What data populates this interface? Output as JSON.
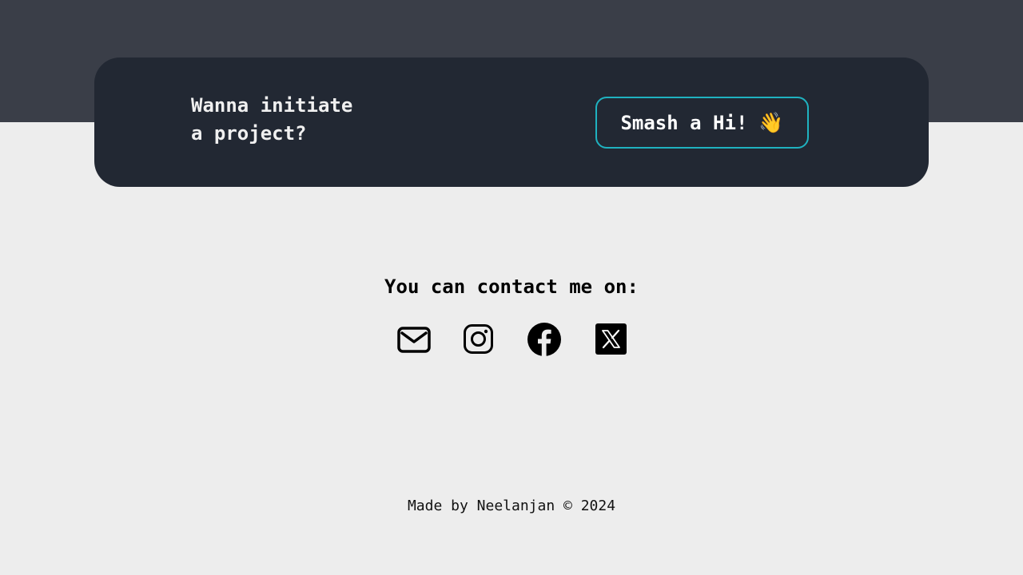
{
  "cta": {
    "line1": "Wanna initiate",
    "line2": "a project?",
    "button_label": "Smash a Hi!",
    "button_emoji": "👋"
  },
  "contact": {
    "title": "You can contact me on:",
    "links": [
      {
        "icon": "mail-icon"
      },
      {
        "icon": "instagram-icon"
      },
      {
        "icon": "facebook-icon"
      },
      {
        "icon": "x-icon"
      }
    ]
  },
  "footer": {
    "text": "Made by Neelanjan © 2024"
  },
  "colors": {
    "top_band": "#3a3e48",
    "card": "#222833",
    "button_border": "#1fb2c0",
    "page_bg": "#ededed"
  }
}
